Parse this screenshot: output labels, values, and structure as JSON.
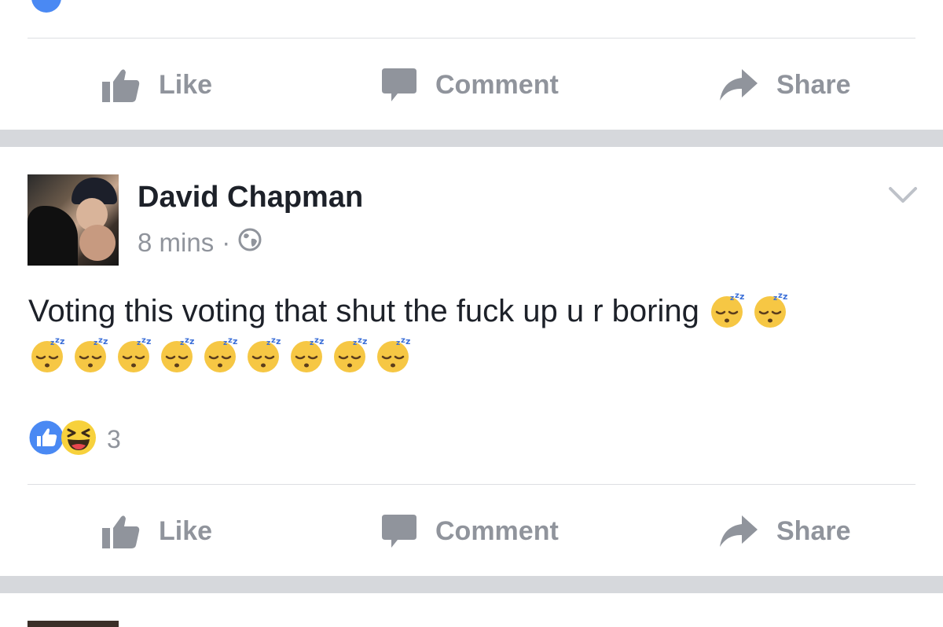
{
  "top_action_bar": {
    "like_label": "Like",
    "comment_label": "Comment",
    "share_label": "Share"
  },
  "post": {
    "author": "David Chapman",
    "time": "8 mins",
    "separator": "·",
    "privacy_icon": "globe-icon",
    "text": "Voting this voting that shut the fuck up u r boring",
    "emoji_icon": "sleeping-face-emoji",
    "emoji_count": 11,
    "reactions": {
      "types": [
        "like-reaction-icon",
        "haha-reaction-icon"
      ],
      "count": "3"
    },
    "actions": {
      "like_label": "Like",
      "comment_label": "Comment",
      "share_label": "Share"
    }
  },
  "colors": {
    "action_gray": "#90949c",
    "separator": "#d6d8dc",
    "like_blue": "#4a89f3",
    "text": "#1d2129"
  }
}
